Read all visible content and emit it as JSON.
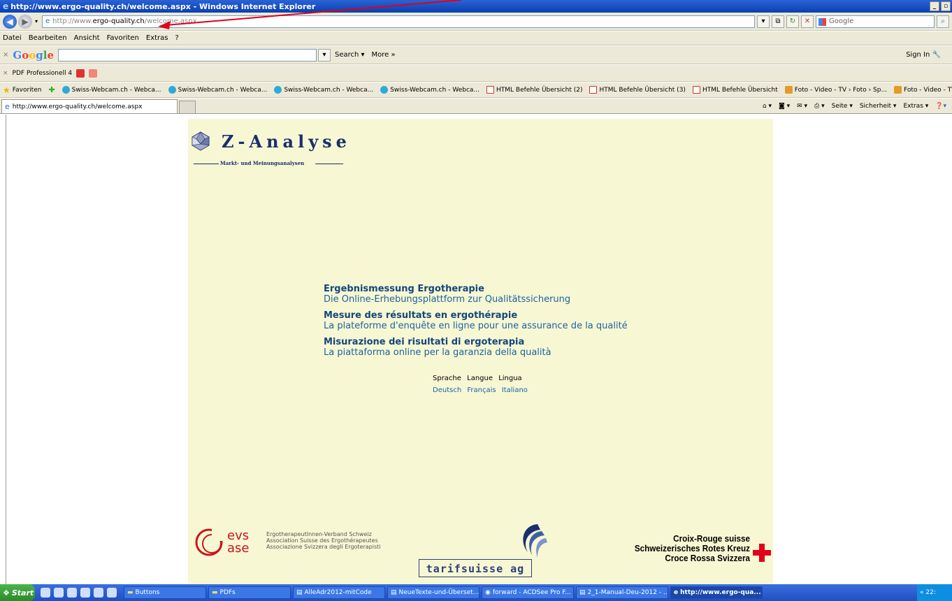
{
  "window": {
    "title": "http://www.ergo-quality.ch/welcome.aspx - Windows Internet Explorer"
  },
  "address_bar": {
    "url_prefix": "http://www.",
    "url_domain": "ergo-quality.ch",
    "url_rest": "/welcome.aspx",
    "search_placeholder": "Google"
  },
  "menu": [
    "Datei",
    "Bearbeiten",
    "Ansicht",
    "Favoriten",
    "Extras",
    "?"
  ],
  "google_toolbar": {
    "close": "×",
    "logo": "Google",
    "search_label": "Search",
    "more_label": "More »",
    "sign_in": "Sign In"
  },
  "pdf_toolbar": {
    "close": "×",
    "label": "PDF Professionell 4"
  },
  "favorites": {
    "label": "Favoriten",
    "items": [
      {
        "label": "Swiss-Webcam.ch - Webca...",
        "icon": "webcam-icon"
      },
      {
        "label": "Swiss-Webcam.ch - Webca...",
        "icon": "webcam-icon"
      },
      {
        "label": "Swiss-Webcam.ch - Webca...",
        "icon": "webcam-icon"
      },
      {
        "label": "Swiss-Webcam.ch - Webca...",
        "icon": "webcam-icon"
      },
      {
        "label": "HTML Befehle Übersicht (2)",
        "icon": "html-icon"
      },
      {
        "label": "HTML Befehle Übersicht (3)",
        "icon": "html-icon"
      },
      {
        "label": "HTML Befehle Übersicht",
        "icon": "html-icon"
      },
      {
        "label": "Foto - Video - TV › Foto › Sp...",
        "icon": "foto-icon"
      },
      {
        "label": "Foto - Video - TV › Foto › Sp...",
        "icon": "foto-icon"
      }
    ]
  },
  "tab": {
    "label": "http://www.ergo-quality.ch/welcome.aspx"
  },
  "command_bar": [
    "Seite ▾",
    "Sicherheit ▾",
    "Extras ▾"
  ],
  "page": {
    "logo": {
      "name": "Z-Analyse",
      "tagline": "Markt- und Meinungsanalysen"
    },
    "intro": [
      {
        "heading": "Ergebnismessung Ergotherapie",
        "sub": "Die Online-Erhebungsplattform zur Qualitätssicherung"
      },
      {
        "heading": "Mesure des résultats en ergothérapie",
        "sub": "La plateforme d'enquête en ligne pour une assurance de la qualité"
      },
      {
        "heading": "Misurazione dei risultati di ergoterapia",
        "sub": "La piattaforma online per la garanzia della qualità"
      }
    ],
    "language": {
      "labels": [
        "Sprache",
        "Langue",
        "Lingua"
      ],
      "links": [
        "Deutsch",
        "Français",
        "Italiano"
      ]
    },
    "evs": {
      "mark1": "evs",
      "mark2": "ase",
      "lines": [
        "ErgotherapeutInnen-Verband Schweiz",
        "Association Suisse des Ergothérapeutes",
        "Associazione Svizzera degli Ergoterapisti"
      ]
    },
    "tarifsuisse": "tarifsuisse ag",
    "red_cross": [
      "Croix-Rouge suisse",
      "Schweizerisches Rotes Kreuz",
      "Croce Rossa Svizzera"
    ]
  },
  "taskbar": {
    "start": "Start",
    "tasks": [
      {
        "label": "Buttons"
      },
      {
        "label": "PDFs"
      },
      {
        "label": "AlleAdr2012-mitCode"
      },
      {
        "label": "NeueTexte-und-Überset..."
      },
      {
        "label": "forward - ACDSee Pro F..."
      },
      {
        "label": "2_1-Manual-Deu-2012 - ..."
      },
      {
        "label": "http://www.ergo-qua..."
      }
    ],
    "clock": "« 22:"
  },
  "colors": {
    "page_background": "#f7f7d4",
    "link": "#1c63a0",
    "brand_navy": "#1a2f6b",
    "evs_red": "#c8161d",
    "annotation_arrow": "#e0001a"
  }
}
